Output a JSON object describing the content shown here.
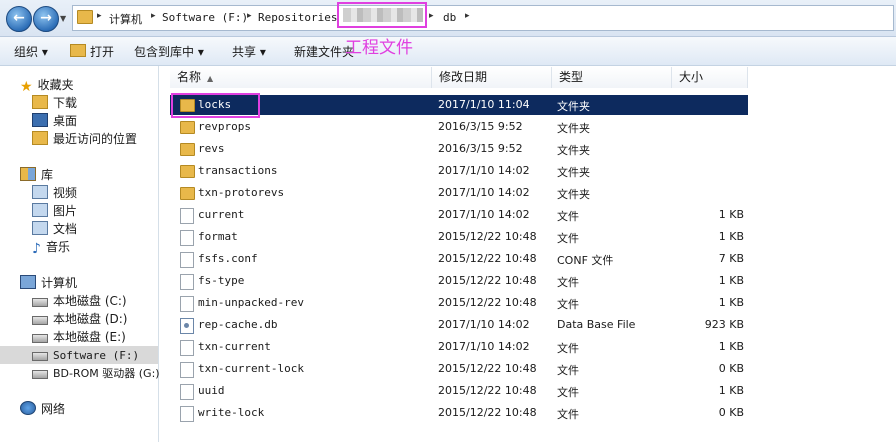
{
  "nav": {
    "back": "←",
    "forward": "→"
  },
  "breadcrumb": [
    "计算机",
    "Software (F:)",
    "Repositories",
    "db"
  ],
  "annotation": "工程文件",
  "toolbar": {
    "organize": "组织 ▾",
    "open": "打开",
    "include": "包含到库中 ▾",
    "share": "共享 ▾",
    "newfolder": "新建文件夹"
  },
  "sidebar": {
    "favorites": "收藏夹",
    "fav_items": [
      "下载",
      "桌面",
      "最近访问的位置"
    ],
    "library": "库",
    "lib_items": [
      "视频",
      "图片",
      "文档",
      "音乐"
    ],
    "computer": "计算机",
    "drives": [
      "本地磁盘 (C:)",
      "本地磁盘 (D:)",
      "本地磁盘 (E:)",
      "Software (F:)",
      "BD-ROM 驱动器 (G:)"
    ],
    "network": "网络"
  },
  "columns": {
    "name": "名称",
    "date": "修改日期",
    "type": "类型",
    "size": "大小"
  },
  "files": [
    {
      "name": "locks",
      "date": "2017/1/10 11:04",
      "type": "文件夹",
      "size": "",
      "kind": "folder"
    },
    {
      "name": "revprops",
      "date": "2016/3/15 9:52",
      "type": "文件夹",
      "size": "",
      "kind": "folder"
    },
    {
      "name": "revs",
      "date": "2016/3/15 9:52",
      "type": "文件夹",
      "size": "",
      "kind": "folder"
    },
    {
      "name": "transactions",
      "date": "2017/1/10 14:02",
      "type": "文件夹",
      "size": "",
      "kind": "folder"
    },
    {
      "name": "txn-protorevs",
      "date": "2017/1/10 14:02",
      "type": "文件夹",
      "size": "",
      "kind": "folder"
    },
    {
      "name": "current",
      "date": "2017/1/10 14:02",
      "type": "文件",
      "size": "1 KB",
      "kind": "file"
    },
    {
      "name": "format",
      "date": "2015/12/22 10:48",
      "type": "文件",
      "size": "1 KB",
      "kind": "file"
    },
    {
      "name": "fsfs.conf",
      "date": "2015/12/22 10:48",
      "type": "CONF 文件",
      "size": "7 KB",
      "kind": "file"
    },
    {
      "name": "fs-type",
      "date": "2015/12/22 10:48",
      "type": "文件",
      "size": "1 KB",
      "kind": "file"
    },
    {
      "name": "min-unpacked-rev",
      "date": "2015/12/22 10:48",
      "type": "文件",
      "size": "1 KB",
      "kind": "file"
    },
    {
      "name": "rep-cache.db",
      "date": "2017/1/10 14:02",
      "type": "Data Base File",
      "size": "923 KB",
      "kind": "db"
    },
    {
      "name": "txn-current",
      "date": "2017/1/10 14:02",
      "type": "文件",
      "size": "1 KB",
      "kind": "file"
    },
    {
      "name": "txn-current-lock",
      "date": "2015/12/22 10:48",
      "type": "文件",
      "size": "0 KB",
      "kind": "file"
    },
    {
      "name": "uuid",
      "date": "2015/12/22 10:48",
      "type": "文件",
      "size": "1 KB",
      "kind": "file"
    },
    {
      "name": "write-lock",
      "date": "2015/12/22 10:48",
      "type": "文件",
      "size": "0 KB",
      "kind": "file"
    }
  ]
}
